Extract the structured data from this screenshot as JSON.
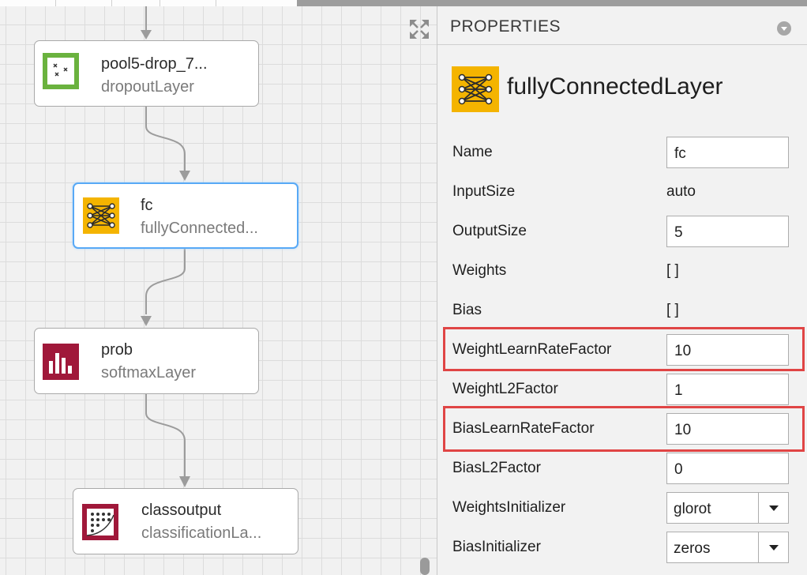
{
  "canvas": {
    "nodes": [
      {
        "name": "pool5-drop_7...",
        "type": "dropoutLayer",
        "icon": "dropout-icon",
        "icon_color": "#6ab23e"
      },
      {
        "name": "fc",
        "type": "fullyConnected...",
        "icon": "fully-connected-icon",
        "icon_color": "#f4b400",
        "selected": true
      },
      {
        "name": "prob",
        "type": "softmaxLayer",
        "icon": "softmax-icon",
        "icon_color": "#a0183a"
      },
      {
        "name": "classoutput",
        "type": "classificationLa...",
        "icon": "classification-icon",
        "icon_color": "#a0183a"
      }
    ]
  },
  "properties": {
    "title": "PROPERTIES",
    "layer_type": "fullyConnectedLayer",
    "rows": [
      {
        "label": "Name",
        "value": "fc",
        "kind": "input"
      },
      {
        "label": "InputSize",
        "value": "auto",
        "kind": "text"
      },
      {
        "label": "OutputSize",
        "value": "5",
        "kind": "input"
      },
      {
        "label": "Weights",
        "value": "[ ]",
        "kind": "text"
      },
      {
        "label": "Bias",
        "value": "[ ]",
        "kind": "text"
      },
      {
        "label": "WeightLearnRateFactor",
        "value": "10",
        "kind": "input",
        "highlighted": true
      },
      {
        "label": "WeightL2Factor",
        "value": "1",
        "kind": "input"
      },
      {
        "label": "BiasLearnRateFactor",
        "value": "10",
        "kind": "input",
        "highlighted": true
      },
      {
        "label": "BiasL2Factor",
        "value": "0",
        "kind": "input"
      },
      {
        "label": "WeightsInitializer",
        "value": "glorot",
        "kind": "select"
      },
      {
        "label": "BiasInitializer",
        "value": "zeros",
        "kind": "select"
      }
    ]
  },
  "colors": {
    "selection_border": "#58a9f6",
    "highlight_box": "#e04545",
    "accent_yellow": "#f4b400",
    "accent_green": "#6ab23e",
    "accent_red": "#a0183a"
  }
}
